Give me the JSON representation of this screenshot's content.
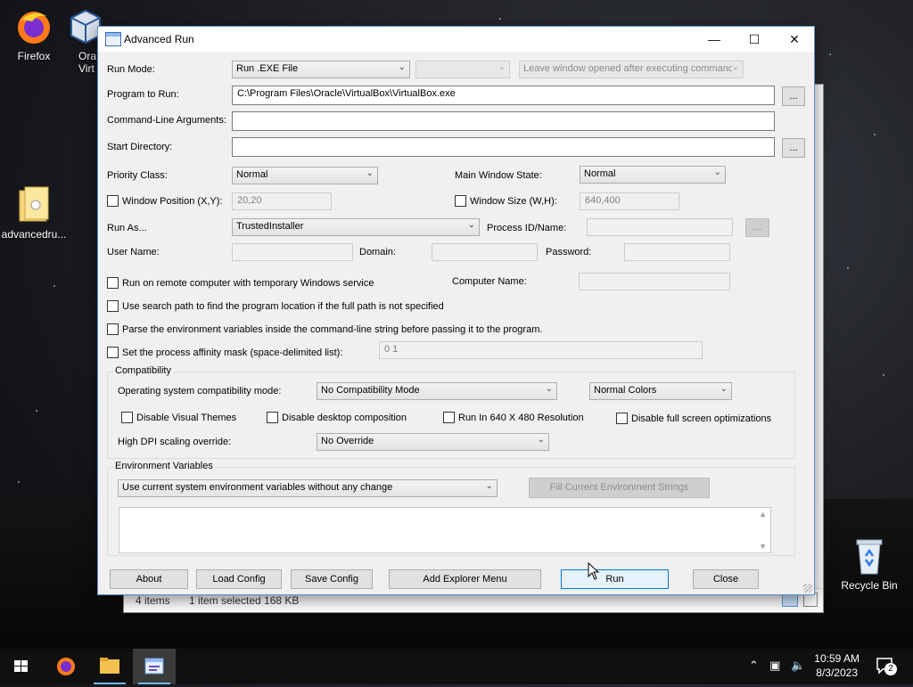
{
  "desktop": {
    "icons": [
      {
        "label": "Firefox"
      },
      {
        "label": "Ora\nVirt"
      },
      {
        "label": "advancedru..."
      },
      {
        "label": "Recycle Bin"
      }
    ]
  },
  "explorer": {
    "status_items": "4 items",
    "status_selected": "1 item selected  168 KB"
  },
  "window": {
    "title": "Advanced Run",
    "minimize": "—",
    "maximize": "☐",
    "close": "✕"
  },
  "form": {
    "run_mode_label": "Run Mode:",
    "run_mode_value": "Run .EXE File",
    "run_mode_extra_value": "",
    "leave_window_value": "Leave window opened after executing command",
    "program_label": "Program to Run:",
    "program_value": "C:\\Program Files\\Oracle\\VirtualBox\\VirtualBox.exe",
    "browse_label": "...",
    "args_label": "Command-Line Arguments:",
    "args_value": "",
    "start_dir_label": "Start Directory:",
    "start_dir_value": "",
    "priority_label": "Priority Class:",
    "priority_value": "Normal",
    "main_state_label": "Main Window State:",
    "main_state_value": "Normal",
    "win_pos_label": "Window Position (X,Y):",
    "win_pos_value": "20,20",
    "win_size_label": "Window Size (W,H):",
    "win_size_value": "640,400",
    "run_as_label": "Run As...",
    "run_as_value": "TrustedInstaller",
    "pid_label": "Process ID/Name:",
    "pid_value": "",
    "user_label": "User Name:",
    "domain_label": "Domain:",
    "password_label": "Password:",
    "remote_label": "Run on remote computer with temporary Windows service",
    "computer_label": "Computer Name:",
    "search_path_label": "Use search path to find the program location if the full path is not specified",
    "parse_env_label": "Parse the environment variables inside the command-line string before passing it to the program.",
    "affinity_label": "Set the process affinity mask (space-delimited list):",
    "affinity_value": "0 1"
  },
  "compat": {
    "title": "Compatibility",
    "os_mode_label": "Operating system compatibility mode:",
    "os_mode_value": "No Compatibility Mode",
    "colors_value": "Normal Colors",
    "disable_themes": "Disable Visual Themes",
    "disable_composition": "Disable desktop composition",
    "run_640": "Run In 640 X 480 Resolution",
    "disable_fullscreen": "Disable full screen optimizations",
    "dpi_label": "High DPI scaling override:",
    "dpi_value": "No Override"
  },
  "env": {
    "title": "Environment Variables",
    "mode_value": "Use current system environment variables without any change",
    "fill_button": "Fill Current Environment Strings"
  },
  "buttons": {
    "about": "About",
    "load": "Load Config",
    "save": "Save Config",
    "explorer_menu": "Add Explorer Menu",
    "run": "Run",
    "close": "Close"
  },
  "taskbar": {
    "time": "10:59 AM",
    "date": "8/3/2023",
    "notifications": "2"
  }
}
